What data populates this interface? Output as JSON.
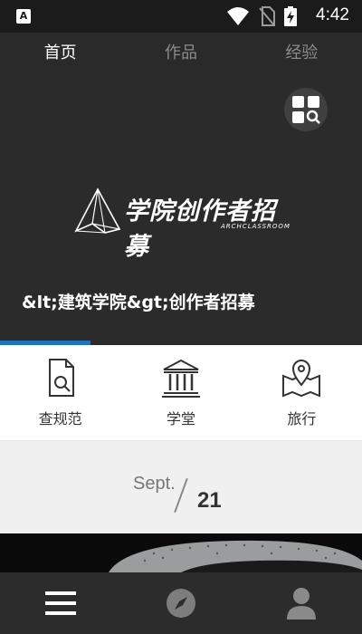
{
  "status_bar": {
    "app_badge": "A",
    "time": "4:42",
    "icons": [
      "wifi-icon",
      "no-sim-icon",
      "battery-charging-icon"
    ]
  },
  "top_tabs": [
    {
      "label": "首页",
      "active": true
    },
    {
      "label": "作品",
      "active": false
    },
    {
      "label": "经验",
      "active": false
    }
  ],
  "banner": {
    "logo_text": "学院创作者招募",
    "logo_sub": "ARCHCLASSROOM",
    "title": "&lt;建筑学院&gt;创作者招募",
    "progress_fraction": 0.25
  },
  "quick_nav": [
    {
      "label": "查规范",
      "icon": "document-search-icon"
    },
    {
      "label": "学堂",
      "icon": "classical-building-icon"
    },
    {
      "label": "旅行",
      "icon": "map-pin-icon"
    }
  ],
  "date": {
    "month": "Sept.",
    "day": "21"
  },
  "bottom_nav": [
    {
      "icon": "menu-icon"
    },
    {
      "icon": "compass-icon"
    },
    {
      "icon": "user-icon"
    }
  ],
  "colors": {
    "accent": "#1e73be",
    "dark_bg": "#2b2b2b",
    "tab_inactive": "#8c8c8c"
  }
}
